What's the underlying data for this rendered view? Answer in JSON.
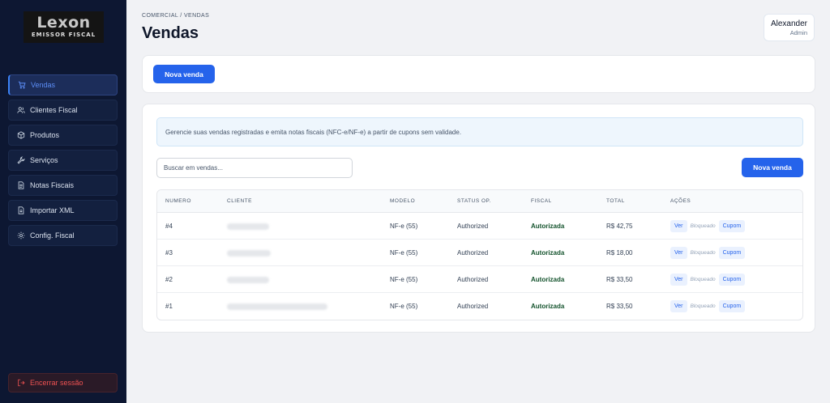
{
  "brand": {
    "name": "Lexon",
    "tagline": "EMISSOR FISCAL"
  },
  "sidebar": {
    "items": [
      {
        "label": "Vendas",
        "icon": "cart-icon",
        "active": true
      },
      {
        "label": "Clientes Fiscal",
        "icon": "users-icon"
      },
      {
        "label": "Produtos",
        "icon": "box-icon"
      },
      {
        "label": "Serviços",
        "icon": "wrench-icon"
      },
      {
        "label": "Notas Fiscais",
        "icon": "document-icon"
      },
      {
        "label": "Importar XML",
        "icon": "file-import-icon"
      },
      {
        "label": "Config. Fiscal",
        "icon": "gear-icon"
      }
    ],
    "logout_label": "Encerrar sessão"
  },
  "header": {
    "breadcrumb": "COMERCIAL / VENDAS",
    "title": "Vendas"
  },
  "user": {
    "name": "Alexander",
    "role": "Admin"
  },
  "toolbar": {
    "new_sale_label": "Nova venda"
  },
  "main": {
    "info_text": "Gerencie suas vendas registradas e emita notas fiscais (NFC-e/NF-e) a partir de cupons sem validade.",
    "search_placeholder": "Buscar em vendas...",
    "new_sale_label": "Nova venda",
    "table": {
      "columns": [
        "NUMERO",
        "CLIENTE",
        "MODELO",
        "STATUS OP.",
        "FISCAL",
        "TOTAL",
        "AÇÕES"
      ],
      "rows": [
        {
          "numero": "#4",
          "modelo": "NF-e (55)",
          "status": "Authorized",
          "fiscal": "Autorizada",
          "total": "R$ 42,75",
          "ver": "Ver",
          "bloqueado": "Bloqueado",
          "cupom": "Cupom"
        },
        {
          "numero": "#3",
          "modelo": "NF-e (55)",
          "status": "Authorized",
          "fiscal": "Autorizada",
          "total": "R$ 18,00",
          "ver": "Ver",
          "bloqueado": "Bloqueado",
          "cupom": "Cupom"
        },
        {
          "numero": "#2",
          "modelo": "NF-e (55)",
          "status": "Authorized",
          "fiscal": "Autorizada",
          "total": "R$ 33,50",
          "ver": "Ver",
          "bloqueado": "Bloqueado",
          "cupom": "Cupom"
        },
        {
          "numero": "#1",
          "modelo": "NF-e (55)",
          "status": "Authorized",
          "fiscal": "Autorizada",
          "total": "R$ 33,50",
          "ver": "Ver",
          "bloqueado": "Bloqueado",
          "cupom": "Cupom"
        }
      ]
    }
  },
  "colors": {
    "sidebar_bg": "#0d1732",
    "accent": "#2563eb",
    "danger": "#f05252",
    "fiscal_ok": "#14532d"
  }
}
